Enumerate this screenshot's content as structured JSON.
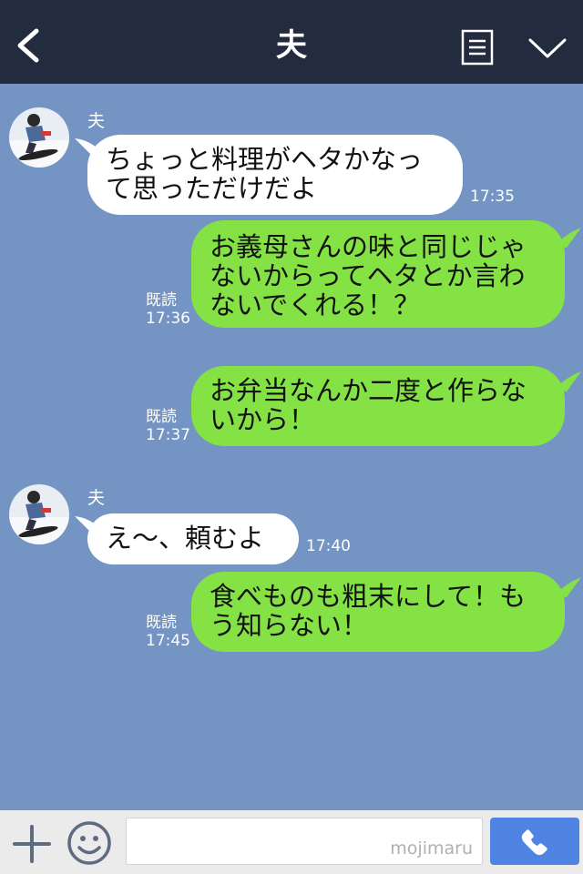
{
  "header": {
    "title": "夫",
    "back_icon": "back-arrow-icon",
    "menu_icon": "note-list-icon",
    "expand_icon": "chevron-down-icon",
    "bg": "#232b3f"
  },
  "chat": {
    "bg": "#7494c4",
    "messages": [
      {
        "side": "in",
        "sender": "夫",
        "lines": [
          "ちょっと料理がヘタかなっ",
          "て思っただけだよ"
        ],
        "time": "17:35"
      },
      {
        "side": "out",
        "lines": [
          "お義母さんの味と同じじゃ",
          "ないからってヘタとか言わ",
          "ないでくれる！？"
        ],
        "read": "既読",
        "time": "17:36"
      },
      {
        "side": "out",
        "lines": [
          "お弁当なんか二度と作らな",
          "いから！"
        ],
        "read": "既読",
        "time": "17:37"
      },
      {
        "side": "in",
        "sender": "夫",
        "lines": [
          "え〜、頼むよ"
        ],
        "time": "17:40"
      },
      {
        "side": "out",
        "lines": [
          "食べものも粗末にして！も",
          "う知らない！"
        ],
        "read": "既読",
        "time": "17:45"
      }
    ]
  },
  "footer": {
    "watermark": "mojimaru",
    "plus_icon": "plus-icon",
    "sticker_icon": "smiley-icon",
    "call_icon": "phone-icon",
    "call_color": "#4f84e3"
  }
}
